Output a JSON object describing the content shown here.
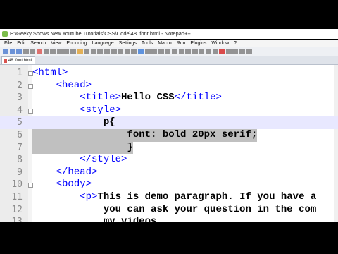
{
  "window": {
    "title": "E:\\Geeky Shows New Youtube Tutorials\\CSS\\Code\\48. font.html - Notepad++"
  },
  "menu": [
    "File",
    "Edit",
    "Search",
    "View",
    "Encoding",
    "Language",
    "Settings",
    "Tools",
    "Macro",
    "Run",
    "Plugins",
    "Window",
    "?"
  ],
  "tab": {
    "label": "48. font.html"
  },
  "editor": {
    "line_numbers": [
      "1",
      "2",
      "3",
      "4",
      "5",
      "6",
      "7",
      "8",
      "9",
      "10",
      "11",
      "12",
      "13"
    ],
    "lines": [
      {
        "parts": [
          {
            "t": "<html>",
            "c": "tag"
          }
        ]
      },
      {
        "parts": [
          {
            "t": "    "
          },
          {
            "t": "<head>",
            "c": "tag"
          }
        ]
      },
      {
        "parts": [
          {
            "t": "        "
          },
          {
            "t": "<title>",
            "c": "tag"
          },
          {
            "t": "Hello CSS",
            "c": "txt"
          },
          {
            "t": "</title>",
            "c": "tag"
          }
        ]
      },
      {
        "parts": [
          {
            "t": "        "
          },
          {
            "t": "<style>",
            "c": "tag"
          }
        ]
      },
      {
        "parts": [
          {
            "t": "            "
          },
          {
            "t": "p{",
            "c": "txt"
          }
        ]
      },
      {
        "parts": [
          {
            "t": "                "
          },
          {
            "t": "font: bold 20px serif;",
            "c": "txt"
          }
        ]
      },
      {
        "parts": [
          {
            "t": "                "
          },
          {
            "t": "}",
            "c": "txt"
          }
        ]
      },
      {
        "parts": [
          {
            "t": "        "
          },
          {
            "t": "</style>",
            "c": "tag"
          }
        ]
      },
      {
        "parts": [
          {
            "t": "    "
          },
          {
            "t": "</head>",
            "c": "tag"
          }
        ]
      },
      {
        "parts": [
          {
            "t": "    "
          },
          {
            "t": "<body>",
            "c": "tag"
          }
        ]
      },
      {
        "parts": [
          {
            "t": "        "
          },
          {
            "t": "<p>",
            "c": "tag"
          },
          {
            "t": "This is demo paragraph. If you have a",
            "c": "txt"
          }
        ]
      },
      {
        "parts": [
          {
            "t": "            "
          },
          {
            "t": "you can ask your question in the com",
            "c": "txt"
          }
        ]
      },
      {
        "parts": [
          {
            "t": "            "
          },
          {
            "t": "my videos.",
            "c": "txt"
          }
        ]
      }
    ]
  },
  "colors": {
    "tag": "#0000ff",
    "text": "#000000",
    "selection": "#c0c0c0",
    "current_line": "#e8e8ff"
  }
}
